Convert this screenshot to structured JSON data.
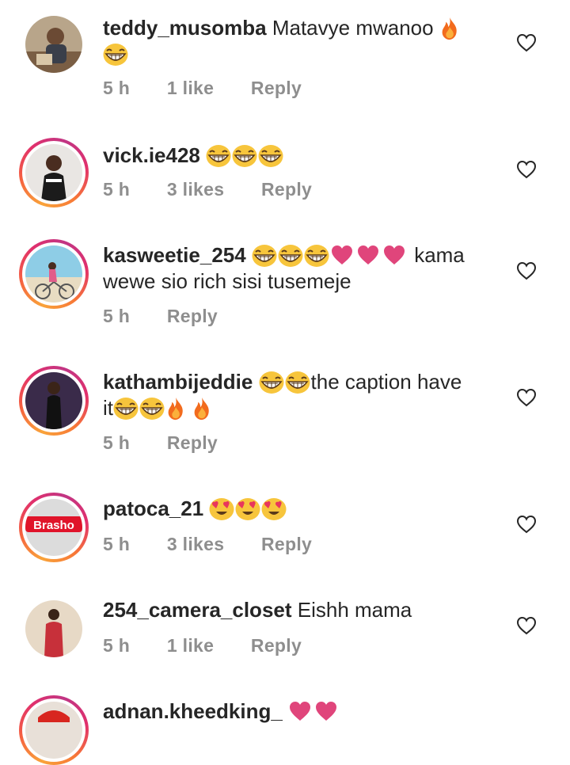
{
  "comments": [
    {
      "username": "teddy_musomba",
      "text": "Matavye mwanoo",
      "time": "5 h",
      "likes": "1 like",
      "reply": "Reply"
    },
    {
      "username": "vick.ie428",
      "text": "",
      "time": "5 h",
      "likes": "3 likes",
      "reply": "Reply"
    },
    {
      "username": "kasweetie_254",
      "text_a": "kama",
      "text_b": "wewe sio rich sisi tusemeje",
      "time": "5 h",
      "reply": "Reply"
    },
    {
      "username": "kathambijeddie",
      "text_a": "the caption have",
      "text_b": "it",
      "time": "5 h",
      "reply": "Reply"
    },
    {
      "username": "patoca_21",
      "text": "",
      "time": "5 h",
      "likes": "3 likes",
      "reply": "Reply",
      "avatar_label": "Brasho"
    },
    {
      "username": "254_camera_closet",
      "text": "Eishh mama",
      "time": "5 h",
      "likes": "1 like",
      "reply": "Reply"
    },
    {
      "username": "adnan.kheedking_",
      "text": ""
    }
  ],
  "icons": {
    "like": "heart-outline-icon",
    "laugh": "grinning-squinting-face-emoji",
    "fire": "fire-emoji",
    "heart": "red-heart-emoji",
    "heart_eyes": "smiling-face-with-heart-eyes-emoji"
  },
  "colors": {
    "username": "#262626",
    "meta": "#8e8e8e",
    "heart_emoji": "#e0457b",
    "story_ring": "#e1306c"
  }
}
